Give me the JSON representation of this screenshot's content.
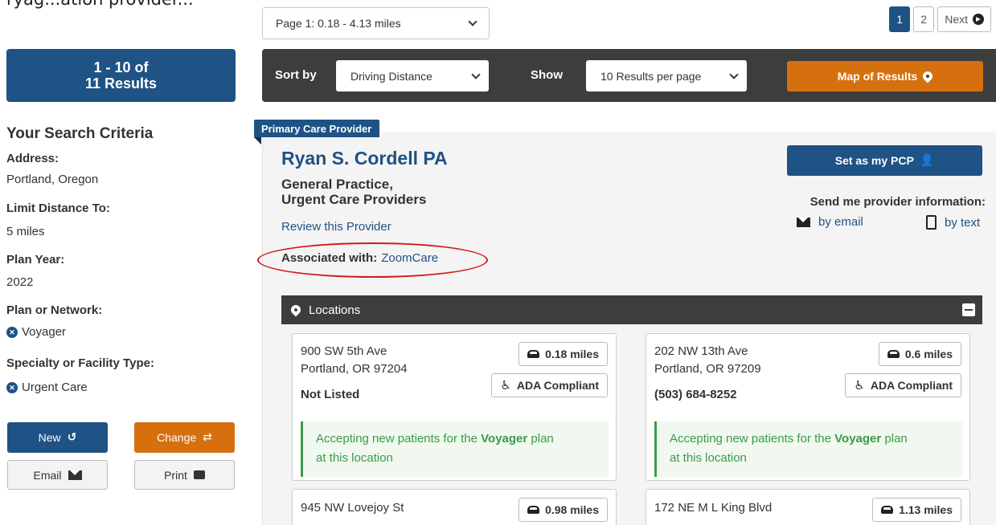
{
  "pagination": {
    "page_select": "Page 1: 0.18 - 4.13 miles",
    "pages": [
      "1",
      "2"
    ],
    "next_label": "Next"
  },
  "results": {
    "line1": "1 - 10 of",
    "line2": "11 Results"
  },
  "sortbar": {
    "sort_label": "Sort by",
    "sort_value": "Driving Distance",
    "show_label": "Show",
    "show_value": "10 Results per page",
    "map_button": "Map of Results"
  },
  "criteria": {
    "title": "Your Search Criteria",
    "address_label": "Address:",
    "address_value": "Portland, Oregon",
    "distance_label": "Limit Distance To:",
    "distance_value": "5 miles",
    "plan_year_label": "Plan Year:",
    "plan_year_value": "2022",
    "network_label": "Plan or Network:",
    "network_value": "Voyager",
    "specialty_label": "Specialty or Facility Type:",
    "specialty_value": "Urgent Care"
  },
  "sidebar_buttons": {
    "new": "New",
    "change": "Change",
    "email": "Email",
    "print": "Print"
  },
  "provider": {
    "tag": "Primary Care Provider",
    "name": "Ryan S. Cordell PA",
    "specialty_line1": "General Practice,",
    "specialty_line2": "Urgent Care Providers",
    "review_link": "Review this Provider",
    "associated_label": "Associated with:",
    "associated_value": "ZoomCare",
    "pcp_button": "Set as my PCP",
    "send_info": "Send me provider information:",
    "by_email": "by email",
    "by_text": "by text"
  },
  "locations": {
    "header": "Locations",
    "accepting_prefix": "Accepting new patients for the",
    "accepting_plan": "Voyager",
    "accepting_suffix1": "plan",
    "accepting_suffix2": "at this location",
    "ada_label": "ADA Compliant",
    "items": [
      {
        "street": "900 SW 5th Ave",
        "city": "Portland, OR 97204",
        "phone": "Not Listed",
        "distance": "0.18 miles"
      },
      {
        "street": "202 NW 13th Ave",
        "city": "Portland, OR 97209",
        "phone": "(503) 684-8252",
        "distance": "0.6 miles"
      },
      {
        "street": "945 NW Lovejoy St",
        "distance": "0.98 miles"
      },
      {
        "street": "172 NE M L King Blvd",
        "distance": "1.13 miles"
      }
    ]
  }
}
